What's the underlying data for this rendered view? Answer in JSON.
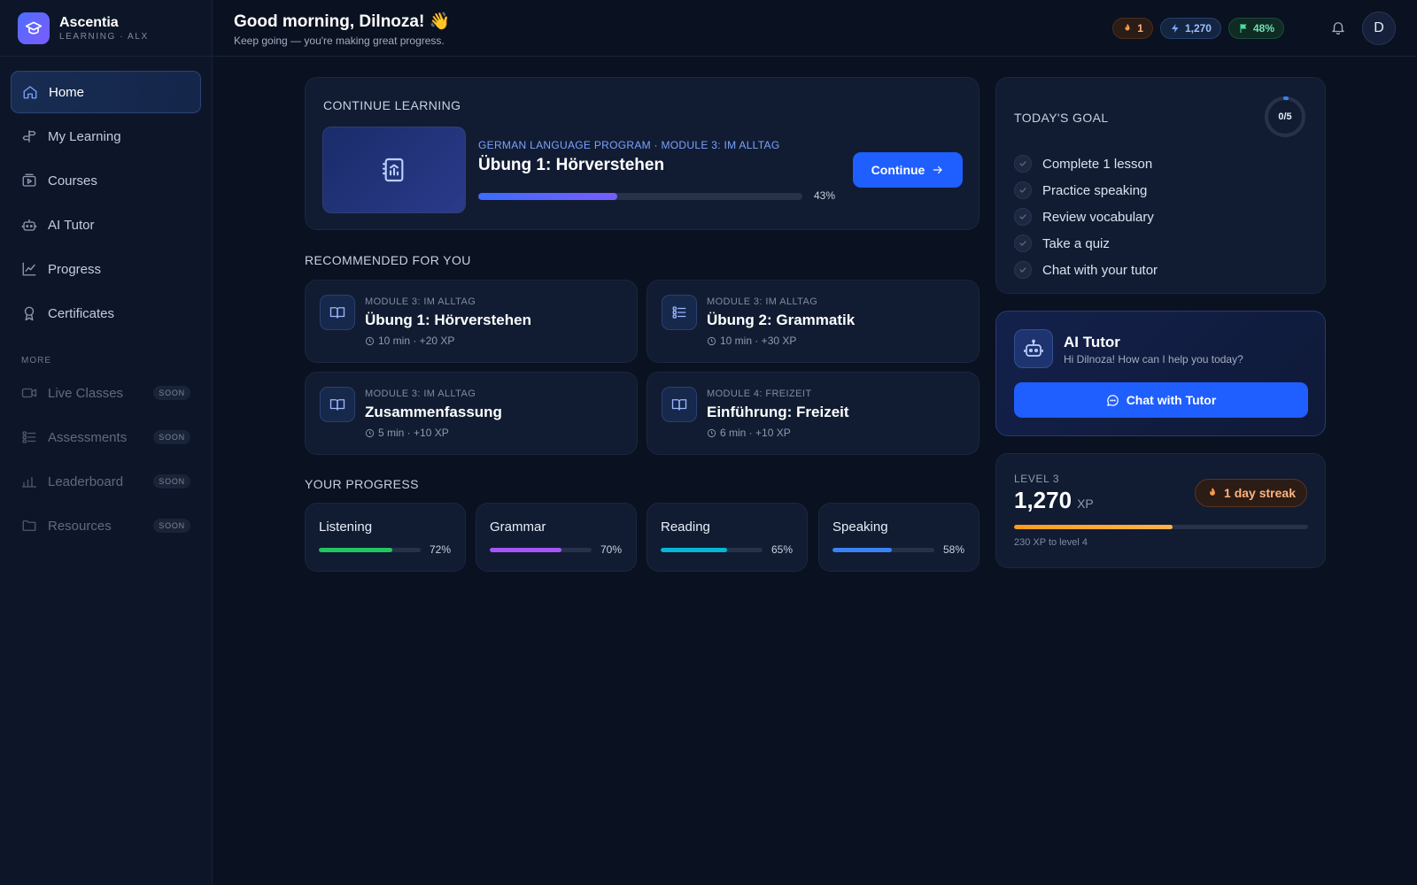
{
  "brand": {
    "name": "Ascentia",
    "subtitle": "LEARNING · ALX"
  },
  "nav": {
    "items": [
      {
        "label": "Home",
        "icon": "home-icon"
      },
      {
        "label": "My Learning",
        "icon": "signpost-icon"
      },
      {
        "label": "Courses",
        "icon": "play-icon"
      },
      {
        "label": "AI Tutor",
        "icon": "robot-icon"
      },
      {
        "label": "Progress",
        "icon": "chart-icon"
      },
      {
        "label": "Certificates",
        "icon": "award-icon"
      }
    ],
    "more_label": "MORE",
    "more_items": [
      {
        "label": "Live Classes",
        "badge": "SOON",
        "icon": "video-icon"
      },
      {
        "label": "Assessments",
        "badge": "SOON",
        "icon": "checklist-icon"
      },
      {
        "label": "Leaderboard",
        "badge": "SOON",
        "icon": "bar-chart-icon"
      },
      {
        "label": "Resources",
        "badge": "SOON",
        "icon": "folder-icon"
      }
    ]
  },
  "header": {
    "greeting": "Good morning, Dilnoza! 👋",
    "subtitle": "Keep going — you're making great progress.",
    "streak_count": "1",
    "xp": "1,270",
    "progress": "48%",
    "avatar_initial": "D"
  },
  "continue": {
    "section_title": "CONTINUE LEARNING",
    "program": "GERMAN LANGUAGE PROGRAM · MODULE 3: IM ALLTAG",
    "lesson": "Übung 1: Hörverstehen",
    "progress": 43,
    "progress_label": "43%",
    "button": "Continue"
  },
  "recommended": {
    "section_title": "RECOMMENDED FOR YOU",
    "items": [
      {
        "module": "MODULE 3: IM ALLTAG",
        "title": "Übung 1: Hörverstehen",
        "meta": "10 min · +20 XP",
        "icon": "book-icon"
      },
      {
        "module": "MODULE 3: IM ALLTAG",
        "title": "Übung 2: Grammatik",
        "meta": "10 min · +30 XP",
        "icon": "list-icon"
      },
      {
        "module": "MODULE 3: IM ALLTAG",
        "title": "Zusammenfassung",
        "meta": "5 min · +10 XP",
        "icon": "book-icon"
      },
      {
        "module": "MODULE 4: FREIZEIT",
        "title": "Einführung: Freizeit",
        "meta": "6 min · +10 XP",
        "icon": "book-icon"
      }
    ]
  },
  "progress": {
    "section_title": "YOUR PROGRESS",
    "items": [
      {
        "name": "Listening",
        "value": 72,
        "label": "72%",
        "color": "#22c55e"
      },
      {
        "name": "Grammar",
        "value": 70,
        "label": "70%",
        "color": "#a855f7"
      },
      {
        "name": "Reading",
        "value": 65,
        "label": "65%",
        "color": "#06b6d4"
      },
      {
        "name": "Speaking",
        "value": 58,
        "label": "58%",
        "color": "#3b82f6"
      }
    ]
  },
  "goal": {
    "title": "TODAY'S GOAL",
    "ring_label": "0/5",
    "items": [
      "Complete 1 lesson",
      "Practice speaking",
      "Review vocabulary",
      "Take a quiz",
      "Chat with your tutor"
    ]
  },
  "tutor": {
    "name": "AI Tutor",
    "subtitle": "Hi Dilnoza! How can I help you today?",
    "button": "Chat with Tutor"
  },
  "level": {
    "label": "LEVEL 3",
    "xp": "1,270",
    "xp_unit": "XP",
    "streak": "1 day streak",
    "progress": 54,
    "note": "230 XP to level 4"
  }
}
